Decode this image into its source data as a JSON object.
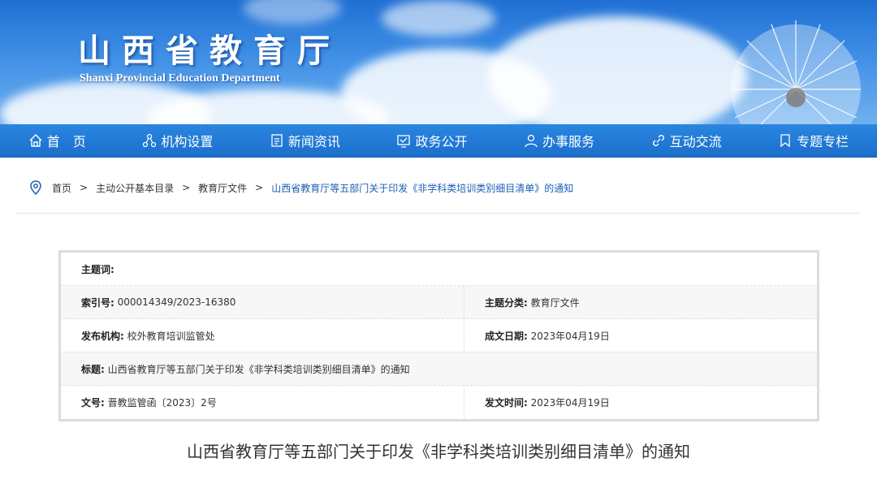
{
  "header": {
    "title_cn": "山西省教育厅",
    "title_en": "Shanxi Provincial Education Department"
  },
  "nav": [
    {
      "label": "首　页",
      "icon": "home-icon"
    },
    {
      "label": "机构设置",
      "icon": "org-chart-icon"
    },
    {
      "label": "新闻资讯",
      "icon": "document-icon"
    },
    {
      "label": "政务公开",
      "icon": "open-affairs-icon"
    },
    {
      "label": "办事服务",
      "icon": "person-service-icon"
    },
    {
      "label": "互动交流",
      "icon": "link-icon"
    },
    {
      "label": "专题专栏",
      "icon": "bookmark-icon"
    }
  ],
  "breadcrumb": {
    "items": [
      "首页",
      "主动公开基本目录",
      "教育厅文件"
    ],
    "current": "山西省教育厅等五部门关于印发《非学科类培训类别细目清单》的通知",
    "separator": ">"
  },
  "meta": {
    "keywords_label": "主题词:",
    "keywords_value": "",
    "index_label": "索引号:",
    "index_value": "000014349/2023-16380",
    "category_label": "主题分类:",
    "category_value": "教育厅文件",
    "publisher_label": "发布机构:",
    "publisher_value": "校外教育培训监管处",
    "date_label": "成文日期:",
    "date_value": "2023年04月19日",
    "title_label": "标题:",
    "title_value": "山西省教育厅等五部门关于印发《非学科类培训类别细目清单》的通知",
    "docno_label": "文号:",
    "docno_value": "晋教监管函〔2023〕2号",
    "pubtime_label": "发文时间:",
    "pubtime_value": "2023年04月19日"
  },
  "article": {
    "title": "山西省教育厅等五部门关于印发《非学科类培训类别细目清单》的通知"
  },
  "colors": {
    "nav_bg": "#1f78d6",
    "link": "#1a5fb4",
    "table_border": "#dcdcdc"
  }
}
